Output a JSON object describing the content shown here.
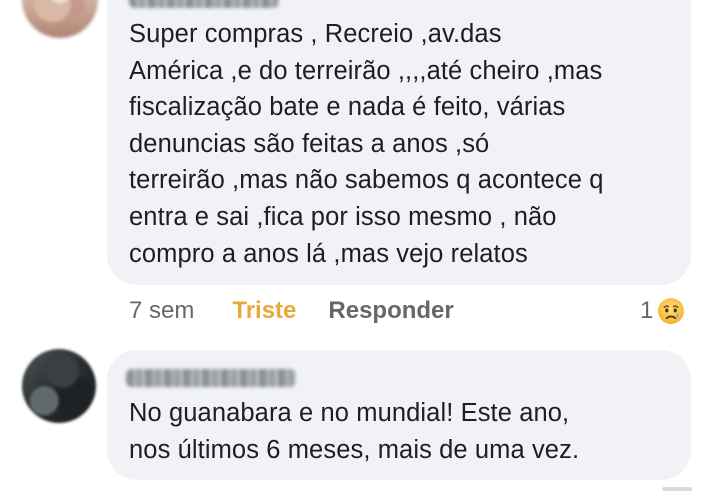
{
  "comments": [
    {
      "author": "Carla Freitas",
      "text": "Super compras , Recreio ,av.das\nAmérica ,e do terreirão ,,,,até cheiro ,mas\nfiscalização bate e nada é feito, várias\ndenuncias são feitas a anos ,só\nterreirão ,mas não sabemos q acontece q\nentra e sai ,fica por isso mesmo , não\ncompro a anos lá ,mas vejo relatos",
      "time": "7 sem",
      "reaction_label": "Triste",
      "reply_label": "Responder",
      "reaction_count": "1",
      "reaction_icon": "sad-emoji",
      "reaction_color": "#e7a93a"
    },
    {
      "author": "Diego Barbinda",
      "text": "No guanabara e no mundial! Este ano,\nnos últimos 6 meses, mais de uma vez."
    }
  ],
  "colors": {
    "bubble": "#f0f2f5",
    "text": "#1c1e21",
    "secondary": "#65676b"
  }
}
